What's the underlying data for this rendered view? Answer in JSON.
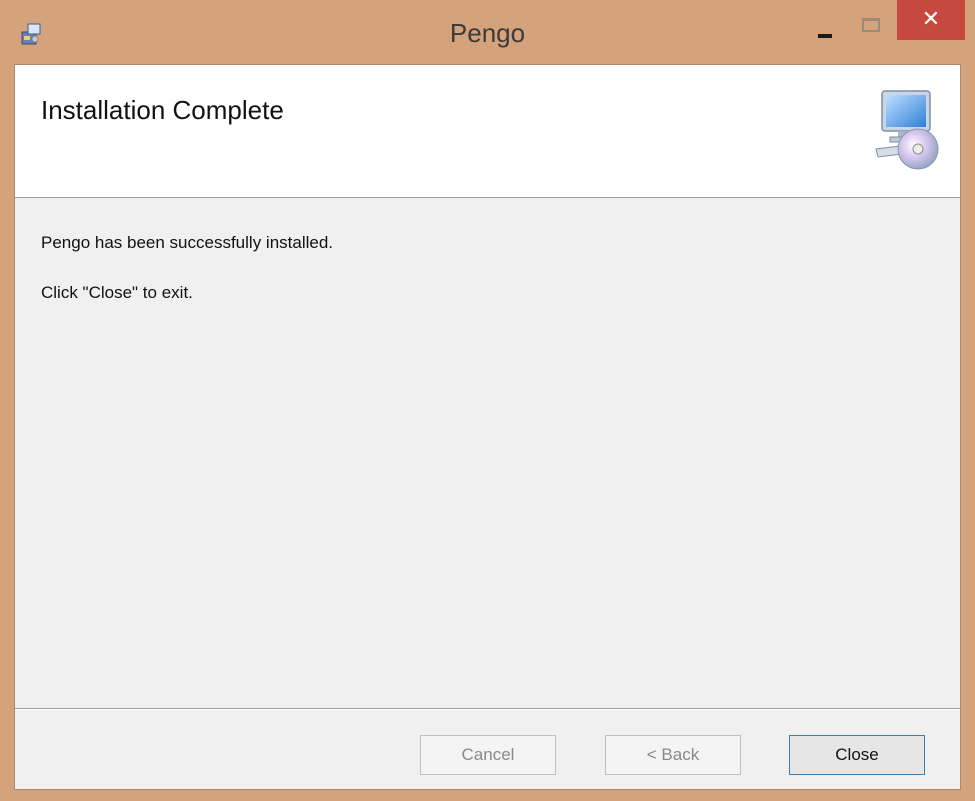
{
  "window": {
    "title": "Pengo",
    "close_glyph": "✕"
  },
  "header": {
    "title": "Installation Complete",
    "graphic_icon": "computer-with-cd-icon"
  },
  "body": {
    "line1": "Pengo has been successfully installed.",
    "line2": "Click \"Close\" to exit."
  },
  "buttons": {
    "cancel": "Cancel",
    "back": "< Back",
    "close": "Close"
  },
  "colors": {
    "frame": "#d4a27b",
    "close_button": "#c7483e",
    "primary_border": "#3c7fb1"
  }
}
